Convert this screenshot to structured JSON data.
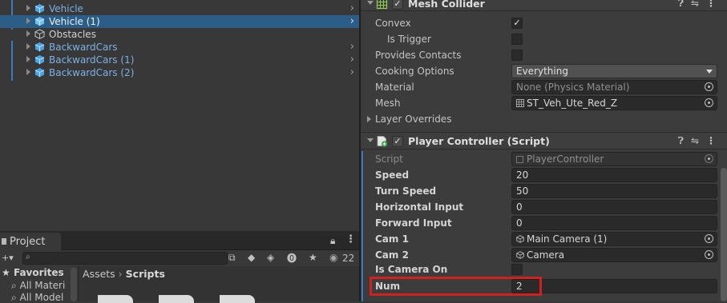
{
  "hierarchy": {
    "items": [
      {
        "label": "Vehicle",
        "style": "blue",
        "chevron": true
      },
      {
        "label": "Vehicle (1)",
        "style": "white",
        "chevron": true,
        "selected": true
      },
      {
        "label": "Obstacles",
        "style": "white",
        "chevron": false
      },
      {
        "label": "BackwardCars",
        "style": "blue",
        "chevron": true
      },
      {
        "label": "BackwardCars (1)",
        "style": "blue",
        "chevron": true
      },
      {
        "label": "BackwardCars (2)",
        "style": "blue",
        "chevron": true
      }
    ]
  },
  "project": {
    "tab_label": "Project",
    "search_value": "",
    "visible_count": "22",
    "favorites_label": "Favorites",
    "favorites": [
      "All Materi",
      "All Model"
    ],
    "breadcrumb": [
      "Assets",
      "Scripts"
    ]
  },
  "mesh_collider": {
    "title": "Mesh Collider",
    "enabled": true,
    "props": {
      "convex_label": "Convex",
      "convex_value": true,
      "is_trigger_label": "Is Trigger",
      "is_trigger_value": false,
      "provides_contacts_label": "Provides Contacts",
      "provides_contacts_value": false,
      "cooking_options_label": "Cooking Options",
      "cooking_options_value": "Everything",
      "material_label": "Material",
      "material_value": "None (Physics Material)",
      "mesh_label": "Mesh",
      "mesh_value": "ST_Veh_Ute_Red_Z",
      "layer_overrides_label": "Layer Overrides"
    }
  },
  "player_controller": {
    "title": "Player Controller (Script)",
    "enabled": true,
    "props": {
      "script_label": "Script",
      "script_value": "PlayerController",
      "speed_label": "Speed",
      "speed_value": "20",
      "turn_speed_label": "Turn Speed",
      "turn_speed_value": "50",
      "horizontal_input_label": "Horizontal Input",
      "horizontal_input_value": "0",
      "forward_input_label": "Forward Input",
      "forward_input_value": "0",
      "cam1_label": "Cam 1",
      "cam1_value": "Main Camera (1)",
      "cam2_label": "Cam 2",
      "cam2_value": "Camera",
      "is_camera_on_label": "Is Camera On",
      "is_camera_on_value": false,
      "num_label": "Num",
      "num_value": "2"
    }
  },
  "colors": {
    "selection": "#2c5d87",
    "prefab_blue": "#7cb1e4",
    "highlight_red": "#d21f1f"
  }
}
